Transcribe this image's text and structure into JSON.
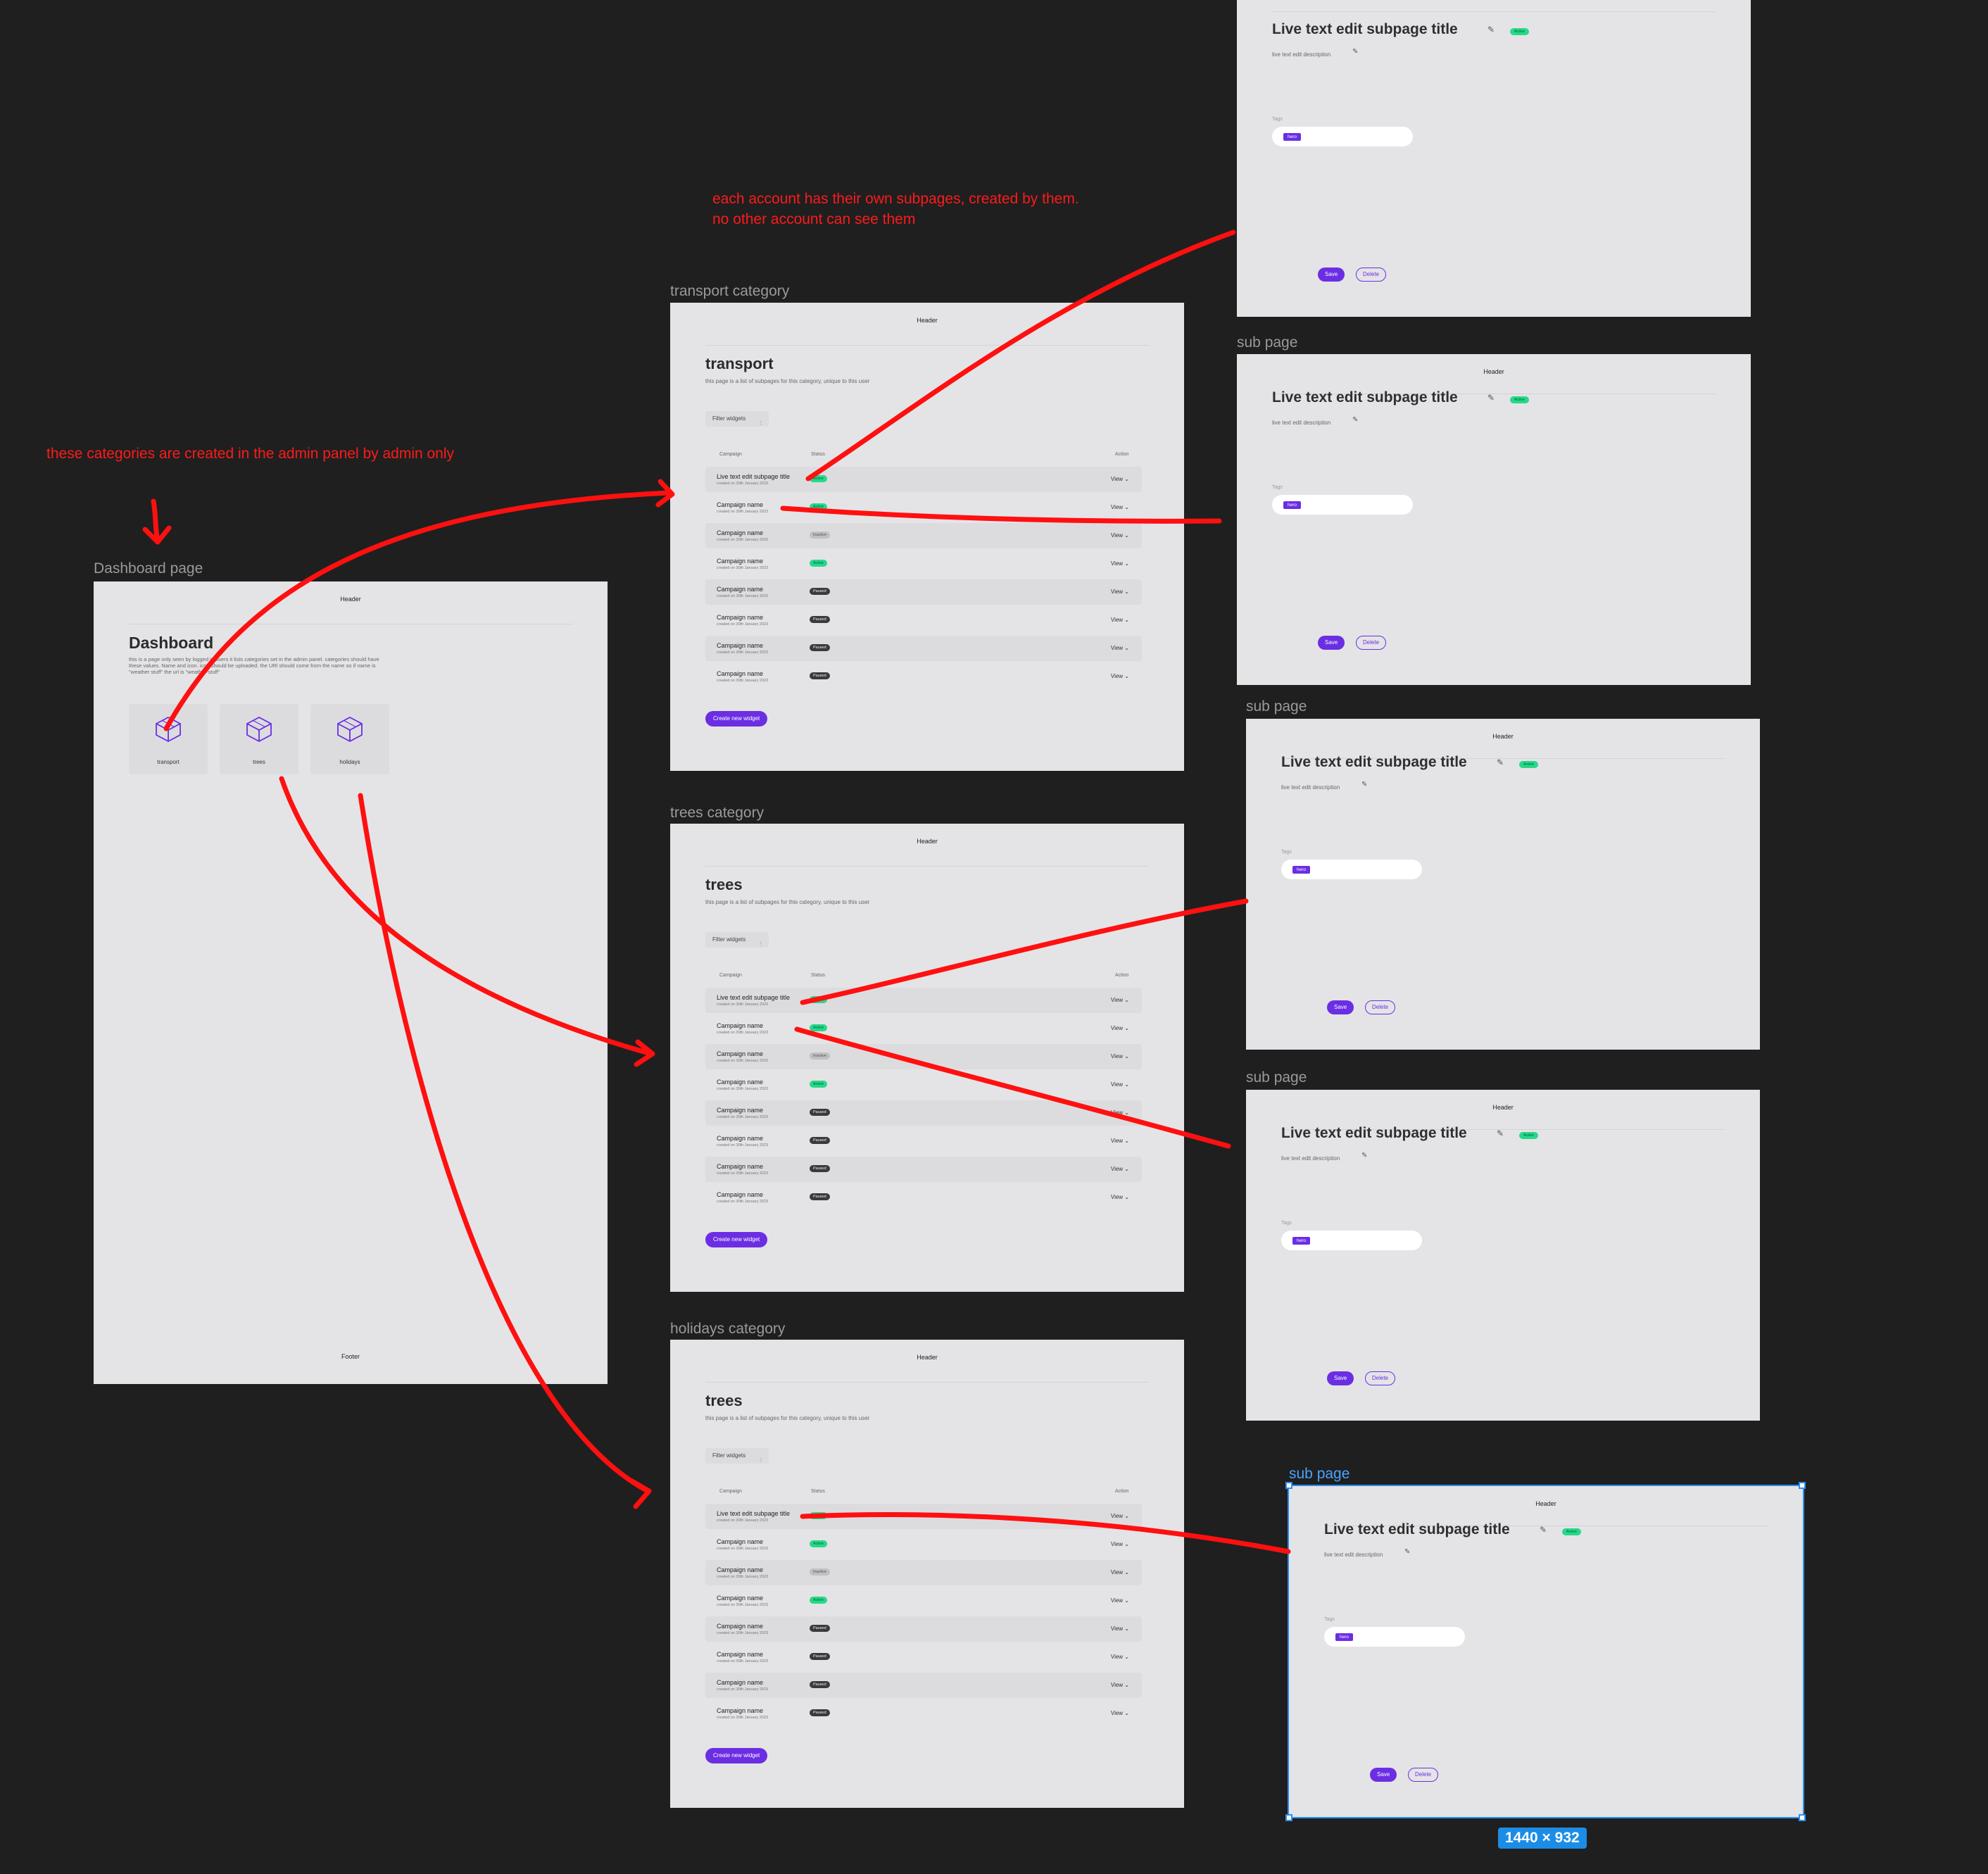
{
  "annotations": {
    "accounts": [
      "each account has their own subpages, created by them.",
      "no other account can see them"
    ],
    "categories": "these categories are created in the admin panel by admin only"
  },
  "dashboard": {
    "label": "Dashboard page",
    "header": "Header",
    "title": "Dashboard",
    "description": "this is a page only seen by logged in users it lists categories set in the admin panel. categories should have these values. Name and icon. icon should be uploaded. the URl should come from the name so if name is \"weather stuff\" the url is \"weather-stuff\"",
    "categories": [
      {
        "label": "transport",
        "icon": "box-3d-icon"
      },
      {
        "label": "trees",
        "icon": "box-3d-icon"
      },
      {
        "label": "holidays",
        "icon": "box-3d-icon"
      }
    ],
    "footer": "Footer"
  },
  "category_pages": [
    {
      "label": "transport category",
      "title": "transport"
    },
    {
      "label": "trees category",
      "title": "trees"
    },
    {
      "label": "holidays category",
      "title": "trees"
    }
  ],
  "category_common": {
    "header": "Header",
    "description": "this page is a list of subpages for this category, unique to this user",
    "filter_label": "Filter widgets",
    "filter_icon": "sliders-icon",
    "columns": [
      "Campaign",
      "Status",
      "Action"
    ],
    "create_button": "Create new widget",
    "rows": [
      {
        "name": "Live text edit subpage title",
        "date": "created on 30th January 2023",
        "status": "Active",
        "action": "View ⌄"
      },
      {
        "name": "Campaign name",
        "date": "created on 30th January 2023",
        "status": "Active",
        "action": "View ⌄"
      },
      {
        "name": "Campaign name",
        "date": "created on 30th January 2023",
        "status": "Inactive",
        "action": "View ⌄"
      },
      {
        "name": "Campaign name",
        "date": "created on 30th January 2023",
        "status": "Active",
        "action": "View ⌄"
      },
      {
        "name": "Campaign name",
        "date": "created on 30th January 2023",
        "status": "Paused",
        "action": "View ⌄"
      },
      {
        "name": "Campaign name",
        "date": "created on 30th January 2023",
        "status": "Paused",
        "action": "View ⌄"
      },
      {
        "name": "Campaign name",
        "date": "created on 30th January 2023",
        "status": "Paused",
        "action": "View ⌄"
      },
      {
        "name": "Campaign name",
        "date": "created on 30th January 2023",
        "status": "Paused",
        "action": "View ⌄"
      }
    ]
  },
  "sub_page_label": "sub page",
  "sub_common": {
    "header": "Header",
    "title": "Live text edit subpage title",
    "badge": "Active",
    "edit_icon": "pencil-icon",
    "description": "live text edit description",
    "tags_label": "Tags",
    "tag": "hero",
    "save": "Save",
    "delete": "Delete"
  },
  "selection_size": "1440 × 932",
  "colors": {
    "accent": "#6b2ee3",
    "active": "#25d98a",
    "annotation": "#ff1a1a",
    "selection": "#2c8ef0"
  }
}
